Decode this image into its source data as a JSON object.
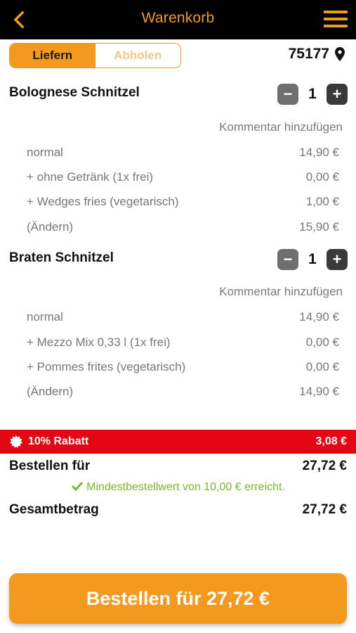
{
  "header": {
    "title": "Warenkorb",
    "back_icon": "chevron-left-icon",
    "menu_icon": "hamburger-menu-icon",
    "color": "#f39a1e"
  },
  "delivery_toggle": {
    "options": [
      "Liefern",
      "Abholen"
    ],
    "selected": "Liefern"
  },
  "location": {
    "zip": "75177",
    "icon": "map-pin-icon"
  },
  "items": [
    {
      "name": "Bolognese Schnitzel",
      "quantity": "1",
      "comment_label": "Kommentar hinzufügen",
      "lines": [
        {
          "label": "normal",
          "price": "14,90 €"
        },
        {
          "label": "+ ohne Getränk (1x frei)",
          "price": "0,00 €"
        },
        {
          "label": "+ Wedges fries (vegetarisch)",
          "price": "1,00 €"
        },
        {
          "label": "(Ändern)",
          "price": "15,90 €"
        }
      ]
    },
    {
      "name": "Braten Schnitzel",
      "quantity": "1",
      "comment_label": "Kommentar hinzufügen",
      "lines": [
        {
          "label": "normal",
          "price": "14,90 €"
        },
        {
          "label": "+ Mezzo Mix 0,33 l (1x frei)",
          "price": "0,00 €"
        },
        {
          "label": "+ Pommes frites (vegetarisch)",
          "price": "0,00 €"
        },
        {
          "label": "(Ändern)",
          "price": "14,90 €"
        }
      ]
    }
  ],
  "qty_controls": {
    "minus": "−",
    "plus": "+"
  },
  "discount": {
    "label": "10% Rabatt",
    "amount": "3,08 €",
    "color": "#e30613"
  },
  "summary": {
    "order_for_label": "Bestellen für",
    "order_for_value": "27,72 €",
    "min_order_message": "Mindestbestellwert von 10,00 € erreicht.",
    "total_label": "Gesamtbetrag",
    "total_value": "27,72 €"
  },
  "order_button": {
    "label": "Bestellen für 27,72 €"
  }
}
